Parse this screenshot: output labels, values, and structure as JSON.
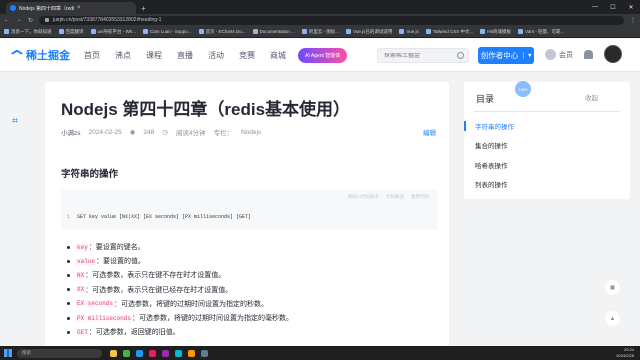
{
  "browser": {
    "tab_title": "Nodejs 第四十四章（redis基本...",
    "url": "juejin.cn/post/7338778403553312802#heading-1",
    "bookmarks": [
      "消息一下，你就知道",
      "百度翻译",
      "uni导航平台 - Wh...",
      "Cam Luan - Suppo...",
      "首页 - ECharts Do...",
      "Documentation ...",
      "阿里云 - 图标...",
      "Vue.js已的调试适用",
      "Vue.js",
      "Tailwind CSS 中文...",
      "H5商城模板",
      "Vant - 轻量、可靠..."
    ]
  },
  "site": {
    "logo_text": "稀土掘金",
    "nav": [
      "首页",
      "沸点",
      "课程",
      "直播",
      "活动",
      "竞赛",
      "商城"
    ],
    "ai_button": "AI Agent 智能体",
    "search_placeholder": "探索稀土掘金",
    "create_button": "创作者中心",
    "vip_label": "会员"
  },
  "article": {
    "title": "Nodejs 第四十四章（redis基本使用）",
    "author": "小满zs",
    "date": "2024-02-25",
    "views": "248",
    "read_time": "阅读4分钟",
    "column_label": "专栏：",
    "column": "Nodejs",
    "edit_label": "编辑",
    "section_heading": "字符串的操作",
    "code_header": [
      "体验AI代码助手",
      "代码解读",
      "复制代码"
    ],
    "code_line_no": "1",
    "code_line": "SET key value [NX|XX] [EX seconds] [PX milliseconds] [GET]",
    "bullets": [
      {
        "code": "key",
        "text": "：要设置的键名。"
      },
      {
        "code": "value",
        "text": "：要设置的值。"
      },
      {
        "code": "NX",
        "text": "：可选参数，表示只在键不存在时才设置值。"
      },
      {
        "code": "XX",
        "text": "：可选参数，表示只在键已经存在时才设置值。"
      },
      {
        "code": "EX seconds",
        "text": "：可选参数，将键的过期时间设置为指定的秒数。"
      },
      {
        "code": "PX milliseconds",
        "text": "：可选参数，将键的过期时间设置为指定的毫秒数。"
      },
      {
        "code": "GET",
        "text": "：可选参数，返回键的旧值。"
      }
    ]
  },
  "toc": {
    "title": "目录",
    "badge": "1500",
    "collapse_label": "收起",
    "items": [
      "字符串的操作",
      "集合的操作",
      "哈希表操作",
      "列表的操作"
    ]
  },
  "taskbar": {
    "search_placeholder": "搜索",
    "time": "20:24",
    "date": "2024/2/26"
  },
  "colors": {
    "brand": "#1e80ff",
    "text": "#252933",
    "muted": "#8a919f"
  }
}
